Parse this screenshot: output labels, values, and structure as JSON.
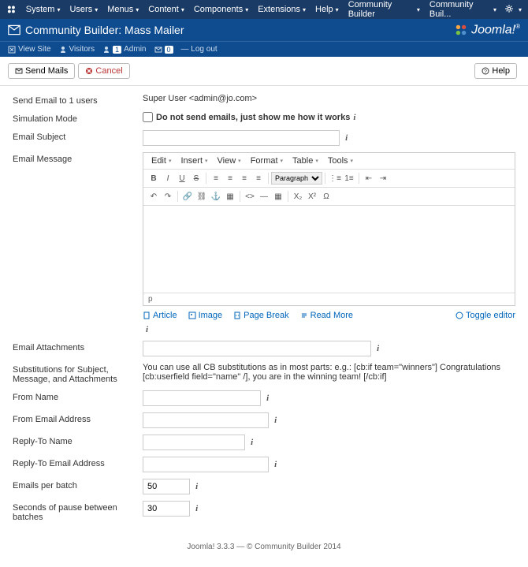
{
  "topmenu": {
    "items": [
      "System",
      "Users",
      "Menus",
      "Content",
      "Components",
      "Extensions",
      "Help",
      "Community Builder"
    ],
    "right_label": "Community Buil..."
  },
  "titlebar": {
    "title": "Community Builder: Mass Mailer",
    "brand": "Joomla!"
  },
  "subbar": {
    "view_site": "View Site",
    "visitors": "Visitors",
    "admin": "Admin",
    "messages": "",
    "logout": "Log out"
  },
  "toolbar": {
    "send": "Send Mails",
    "cancel": "Cancel",
    "help": "Help"
  },
  "form": {
    "send_to_label": "Send Email to 1 users",
    "send_to_value": "Super User <admin@jo.com>",
    "simulation_label": "Simulation Mode",
    "simulation_checkbox": "Do not send emails, just show me how it works",
    "subject_label": "Email Subject",
    "message_label": "Email Message",
    "attachments_label": "Email Attachments",
    "substitutions_label": "Substitutions for Subject, Message, and Attachments",
    "substitutions_text": "You can use all CB substitutions as in most parts: e.g.: [cb:if team=\"winners\"] Congratulations [cb:userfield field=\"name\" /], you are in the winning team! [/cb:if]",
    "from_name_label": "From Name",
    "from_email_label": "From Email Address",
    "reply_name_label": "Reply-To Name",
    "reply_email_label": "Reply-To Email Address",
    "per_batch_label": "Emails per batch",
    "per_batch_value": "50",
    "pause_label": "Seconds of pause between batches",
    "pause_value": "30"
  },
  "editor": {
    "menus": [
      "Edit",
      "Insert",
      "View",
      "Format",
      "Table",
      "Tools"
    ],
    "format_select": "Paragraph",
    "status": "p",
    "buttons": {
      "article": "Article",
      "image": "Image",
      "pagebreak": "Page Break",
      "readmore": "Read More",
      "toggle": "Toggle editor"
    }
  },
  "footer": "Joomla! 3.3.3  —  © Community Builder 2014"
}
